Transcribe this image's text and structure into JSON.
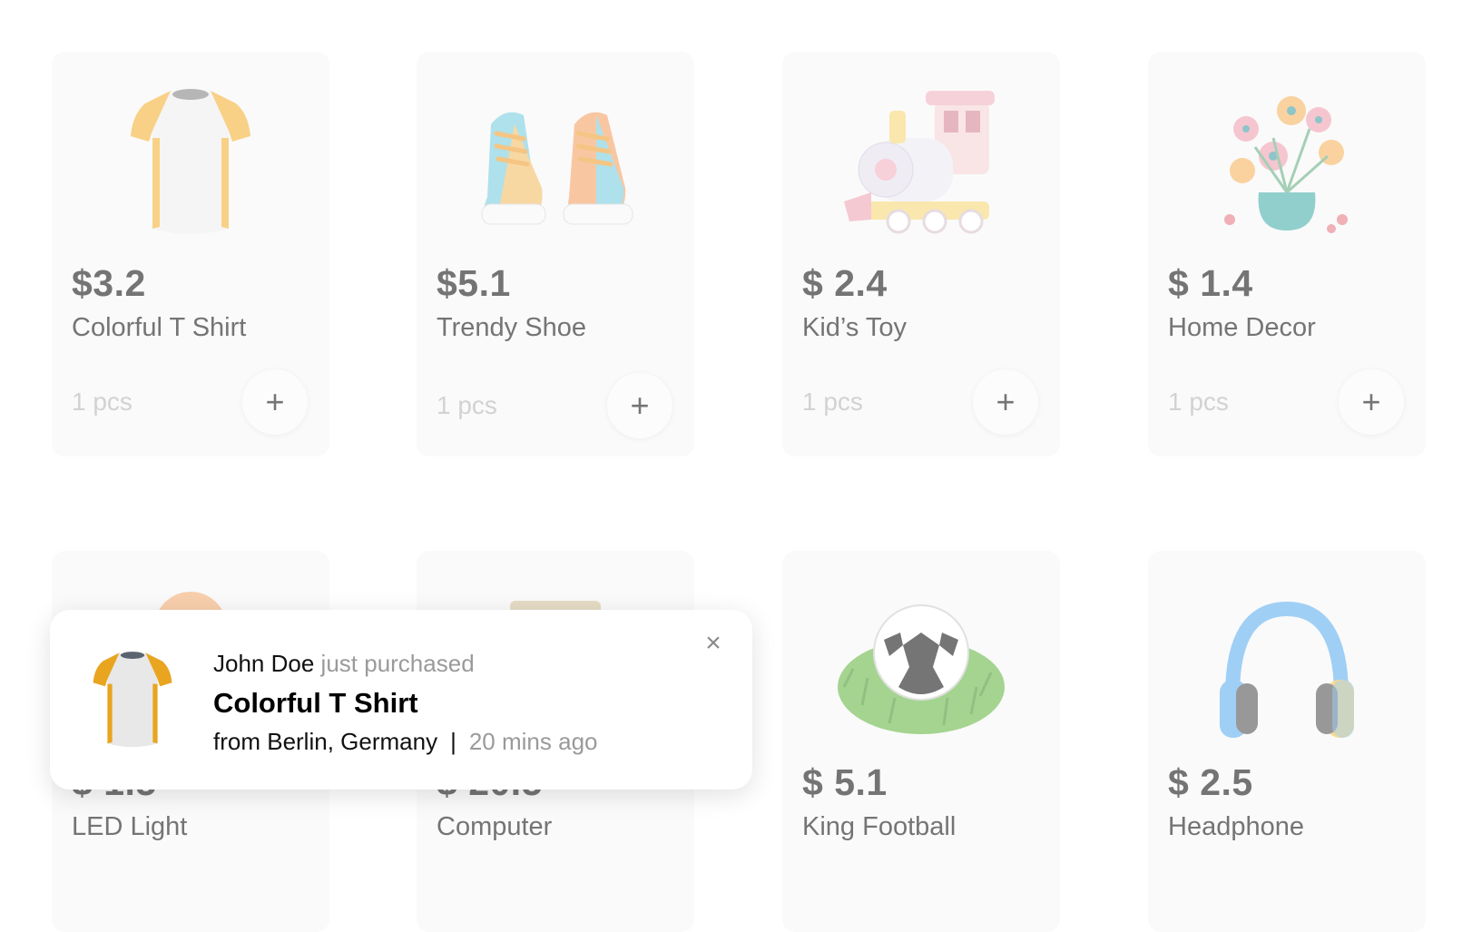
{
  "products": [
    {
      "price": "$3.2",
      "name": "Colorful T Shirt",
      "qty": "1 pcs",
      "icon": "tshirt-icon"
    },
    {
      "price": "$5.1",
      "name": "Trendy Shoe",
      "qty": "1 pcs",
      "icon": "shoe-icon"
    },
    {
      "price": "$ 2.4",
      "name": "Kid’s Toy",
      "qty": "1 pcs",
      "icon": "toy-train-icon"
    },
    {
      "price": "$ 1.4",
      "name": "Home Decor",
      "qty": "1 pcs",
      "icon": "flower-vase-icon"
    },
    {
      "price": "$ 1.5",
      "name": "LED Light",
      "icon": "lamp-icon"
    },
    {
      "price": "$ 20.5",
      "name": "Computer",
      "icon": "monitor-icon"
    },
    {
      "price": "$ 5.1",
      "name": "King Football",
      "icon": "football-icon"
    },
    {
      "price": "$ 2.5",
      "name": "Headphone",
      "icon": "headphone-icon"
    }
  ],
  "add_label": "+",
  "toast": {
    "buyer": "John Doe",
    "action": "just purchased",
    "product": "Colorful T Shirt",
    "location": "from Berlin, Germany",
    "separator": "|",
    "time": "20 mins ago",
    "close": "×"
  }
}
